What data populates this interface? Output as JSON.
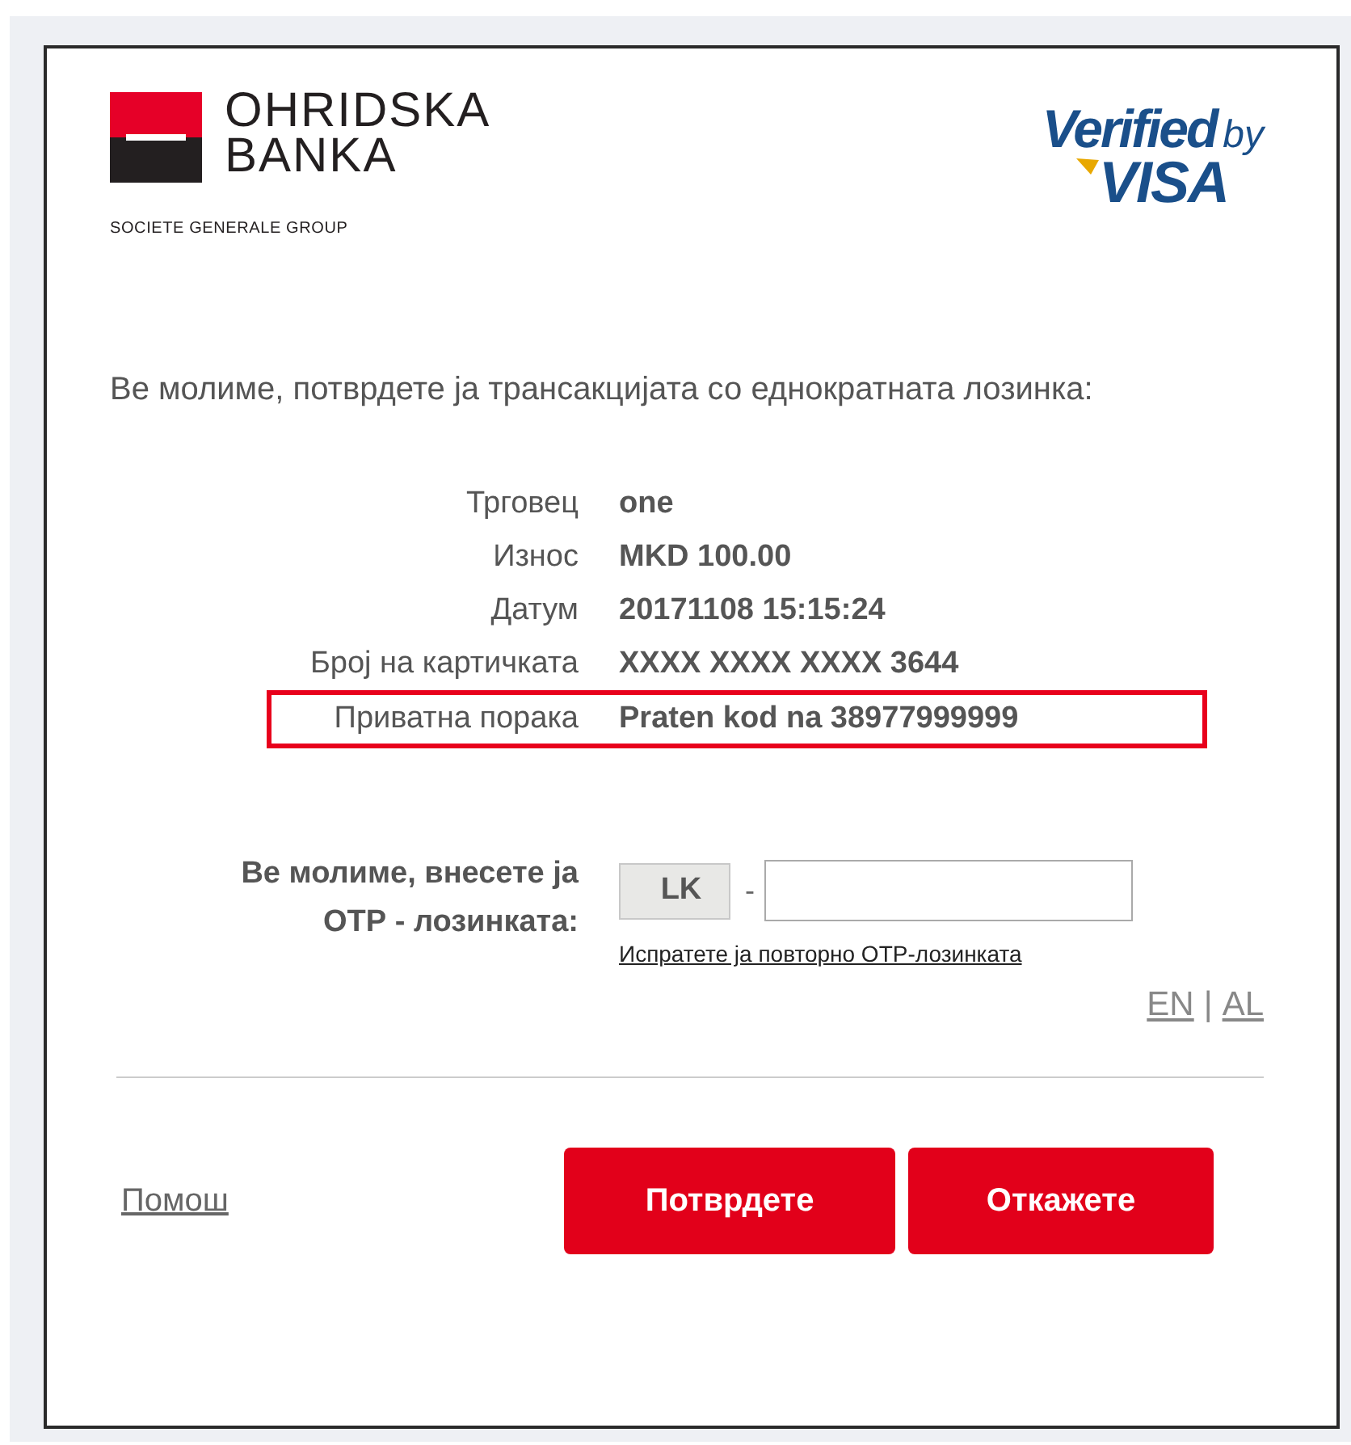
{
  "bank_logo": {
    "name_line_1": "OHRIDSKA",
    "name_line_2": "BANKA",
    "group": "SOCIETE GENERALE GROUP"
  },
  "scheme_logo": {
    "line_1": "Verified",
    "line_1_suffix": "by",
    "line_2": "VISA"
  },
  "instruction": "Ве молиме, потврдете ја трансакцијата со еднократната лозинка:",
  "details": [
    {
      "label": "Трговец",
      "value": "one",
      "highlighted": false
    },
    {
      "label": "Износ",
      "value": "MKD 100.00",
      "highlighted": false
    },
    {
      "label": "Датум",
      "value": "20171108 15:15:24",
      "highlighted": false
    },
    {
      "label": "Број на картичката",
      "value": "XXXX XXXX XXXX 3644",
      "highlighted": false
    },
    {
      "label": "Приватна порака",
      "value": "Praten kod na 38977999999",
      "highlighted": true
    }
  ],
  "otp": {
    "label": "Ве молиме, внесете ја ОТР - лозинката:",
    "prefix": "LK",
    "separator": "-",
    "resend_link": "Испратете ја повторно ОТР-лозинката"
  },
  "languages": [
    {
      "code": "EN"
    },
    {
      "code": "AL"
    }
  ],
  "language_separator": "|",
  "help_link": "Помош",
  "buttons": [
    {
      "label": "Потврдете"
    },
    {
      "label": "Откажете"
    }
  ]
}
